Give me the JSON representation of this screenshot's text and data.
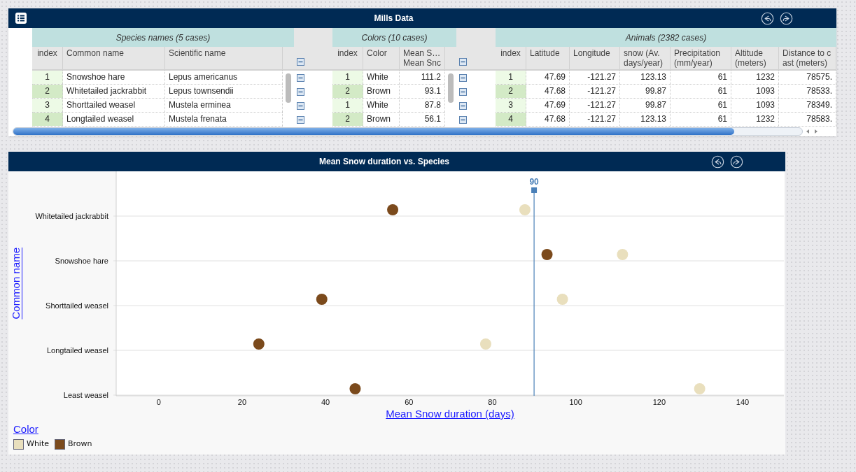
{
  "data_window": {
    "title": "Mills Data",
    "tables": [
      {
        "title": "Species names (5 cases)",
        "columns": [
          {
            "kind": "index",
            "lines": [
              "index"
            ]
          },
          {
            "kind": "text",
            "lines": [
              "Common name"
            ]
          },
          {
            "kind": "text",
            "lines": [
              "Scientific name"
            ]
          }
        ],
        "rows": [
          [
            "1",
            "Snowshoe hare",
            "Lepus americanus"
          ],
          [
            "2",
            "Whitetailed jackrabbit",
            "Lepus townsendii"
          ],
          [
            "3",
            "Shorttailed weasel",
            "Mustela erminea"
          ],
          [
            "4",
            "Longtailed weasel",
            "Mustela frenata"
          ]
        ]
      },
      {
        "title": "Colors (10 cases)",
        "columns": [
          {
            "kind": "index",
            "lines": [
              "index"
            ]
          },
          {
            "kind": "text",
            "lines": [
              "Color"
            ]
          },
          {
            "kind": "number",
            "lines": [
              "Mean S…",
              "Mean Snc"
            ]
          }
        ],
        "rows": [
          [
            "1",
            "White",
            "111.2"
          ],
          [
            "2",
            "Brown",
            "93.1"
          ],
          [
            "1",
            "White",
            "87.8"
          ],
          [
            "2",
            "Brown",
            "56.1"
          ]
        ]
      },
      {
        "title": "Animals (2382 cases)",
        "columns": [
          {
            "kind": "index",
            "lines": [
              "index"
            ]
          },
          {
            "kind": "number",
            "lines": [
              "Latitude"
            ]
          },
          {
            "kind": "number",
            "lines": [
              "Longitude"
            ]
          },
          {
            "kind": "number",
            "lines": [
              "snow (Av.",
              "days/year)"
            ]
          },
          {
            "kind": "number",
            "lines": [
              "Precipitation",
              "(mm/year)"
            ]
          },
          {
            "kind": "number",
            "lines": [
              "Altitude",
              "(meters)"
            ]
          },
          {
            "kind": "number",
            "lines": [
              "Distance to c",
              "ast (meters)"
            ]
          }
        ],
        "rows": [
          [
            "1",
            "47.69",
            "-121.27",
            "123.13",
            "61",
            "1232",
            "78575."
          ],
          [
            "2",
            "47.68",
            "-121.27",
            "99.87",
            "61",
            "1093",
            "78533."
          ],
          [
            "3",
            "47.69",
            "-121.27",
            "99.87",
            "61",
            "1093",
            "78349."
          ],
          [
            "4",
            "47.68",
            "-121.27",
            "123.13",
            "61",
            "1232",
            "78583."
          ]
        ]
      }
    ]
  },
  "chart_window": {
    "title": "Mean Snow duration vs. Species",
    "chart_data": {
      "type": "scatter",
      "orientation": "horizontal",
      "xlabel": "Mean Snow duration (days)",
      "ylabel": "Common name",
      "categories": [
        "Whitetailed jackrabbit",
        "Snowshoe hare",
        "Shorttailed weasel",
        "Longtailed weasel",
        "Least weasel"
      ],
      "series": [
        {
          "name": "White",
          "color": "#e9dfbd",
          "values": [
            87.8,
            111.2,
            96.8,
            78.4,
            129.7
          ]
        },
        {
          "name": "Brown",
          "color": "#7b4a1c",
          "values": [
            56.1,
            93.1,
            39.1,
            24.0,
            47.1
          ]
        }
      ],
      "xlim": [
        -10.2,
        149.9
      ],
      "xticks": [
        0,
        20,
        40,
        60,
        80,
        100,
        120,
        140
      ],
      "grid": true,
      "ref_lines": [
        {
          "axis": "x",
          "value": 90,
          "label": "90"
        }
      ]
    },
    "legend": {
      "title": "Color"
    }
  }
}
